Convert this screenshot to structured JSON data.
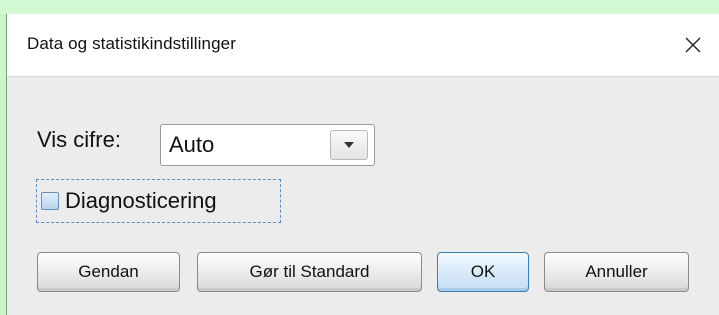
{
  "dialog": {
    "title": "Data og statistikindstillinger",
    "close_icon": "close-icon"
  },
  "form": {
    "digits_label": "Vis cifre:",
    "digits_value": "Auto",
    "dropdown_icon": "chevron-down-icon",
    "diagnostics_label": "Diagnosticering",
    "diagnostics_checked": false
  },
  "buttons": {
    "restore": "Gendan",
    "make_default": "Gør til Standard",
    "ok": "OK",
    "cancel": "Annuller"
  },
  "colors": {
    "background": "#c9f7c9",
    "dialog": "#ececec",
    "focus": "#3c7fb1"
  }
}
